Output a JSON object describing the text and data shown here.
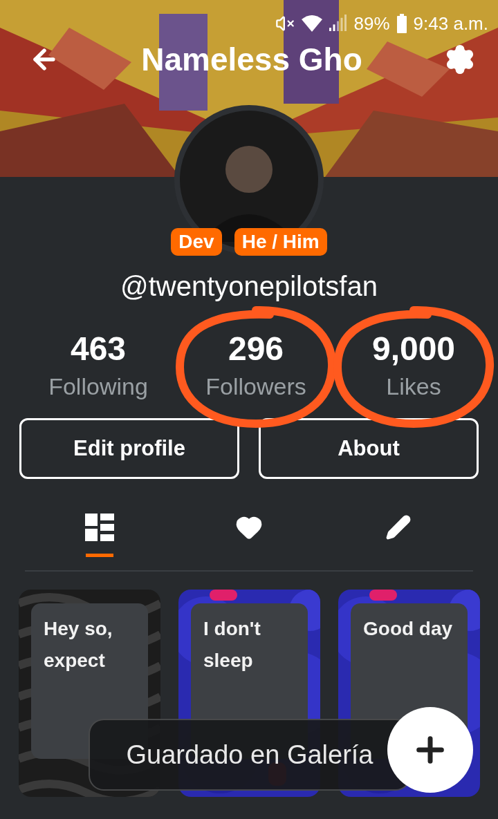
{
  "status_bar": {
    "battery": "89%",
    "time": "9:43 a.m."
  },
  "header": {
    "title": "Nameless Gho"
  },
  "badges": [
    "Dev",
    "He / Him"
  ],
  "handle": "@twentyonepilotsfan",
  "stats": [
    {
      "value": "463",
      "label": "Following",
      "circled": false
    },
    {
      "value": "296",
      "label": "Followers",
      "circled": true
    },
    {
      "value": "9,000",
      "label": "Likes",
      "circled": true
    }
  ],
  "buttons": [
    "Edit profile",
    "About"
  ],
  "tabs": [
    {
      "kind": "posts",
      "selected": true
    },
    {
      "kind": "likes",
      "selected": false
    },
    {
      "kind": "drafts",
      "selected": false
    }
  ],
  "posts": [
    {
      "kind": "swirl",
      "text": "Hey so, expect"
    },
    {
      "kind": "bubbles",
      "text": "I don't sleep"
    },
    {
      "kind": "bubbles",
      "text": "Good day"
    }
  ],
  "toast": "Guardado en Galería"
}
